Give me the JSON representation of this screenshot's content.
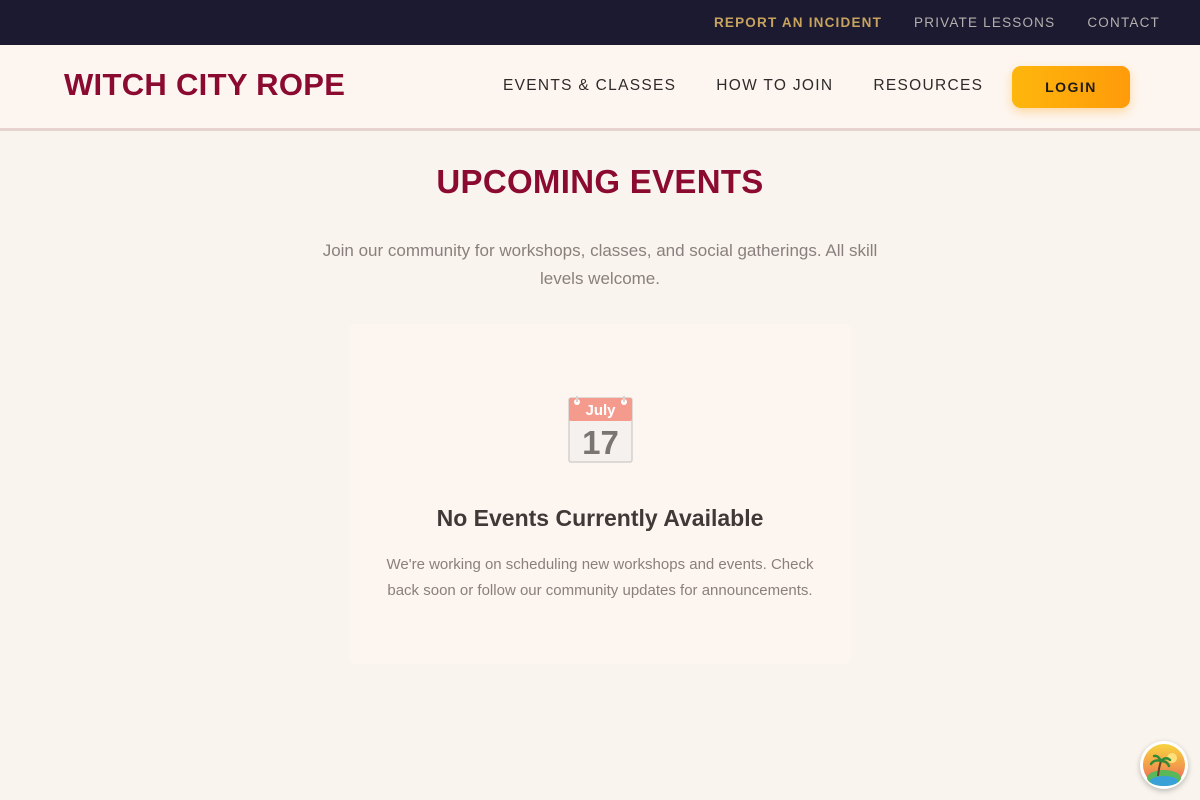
{
  "topbar": {
    "links": [
      {
        "label": "REPORT AN INCIDENT"
      },
      {
        "label": "PRIVATE LESSONS"
      },
      {
        "label": "CONTACT"
      }
    ]
  },
  "header": {
    "logo": "WITCH CITY ROPE",
    "nav": [
      {
        "label": "EVENTS & CLASSES"
      },
      {
        "label": "HOW TO JOIN"
      },
      {
        "label": "RESOURCES"
      }
    ],
    "login_label": "LOGIN"
  },
  "main": {
    "title": "UPCOMING EVENTS",
    "subtitle": "Join our community for workshops, classes, and social gatherings. All skill levels welcome.",
    "empty_state": {
      "icon": "calendar-icon",
      "calendar_month": "July",
      "calendar_day": "17",
      "title": "No Events Currently Available",
      "text": "We're working on scheduling new workshops and events. Check back soon or follow our community updates for announcements."
    }
  },
  "colors": {
    "brand": "#8b0a2f",
    "topbar_bg": "#1b1a30",
    "incident_link": "#c7a35e",
    "login_button": "#ffa50a",
    "page_bg": "#f9f4ee"
  },
  "floating_widget": {
    "icon": "island-avatar-icon"
  }
}
